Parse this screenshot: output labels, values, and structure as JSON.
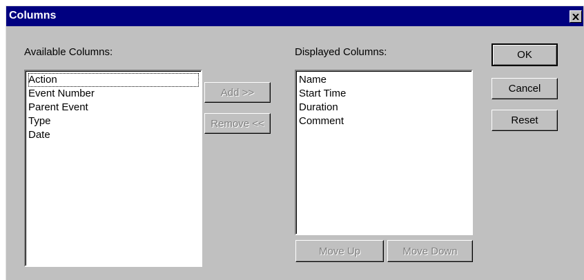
{
  "window": {
    "title": "Columns"
  },
  "available": {
    "label": "Available Columns:",
    "items": [
      "Action",
      "Event Number",
      "Parent Event",
      "Type",
      "Date"
    ]
  },
  "displayed": {
    "label": "Displayed Columns:",
    "items": [
      "Name",
      "Start Time",
      "Duration",
      "Comment"
    ]
  },
  "buttons": {
    "add": "Add >>",
    "remove": "Remove <<",
    "ok": "OK",
    "cancel": "Cancel",
    "reset": "Reset",
    "move_up": "Move Up",
    "move_down": "Move Down"
  },
  "colors": {
    "titlebar": "#000080",
    "face": "#c0c0c0",
    "disabled_text": "#808080"
  }
}
